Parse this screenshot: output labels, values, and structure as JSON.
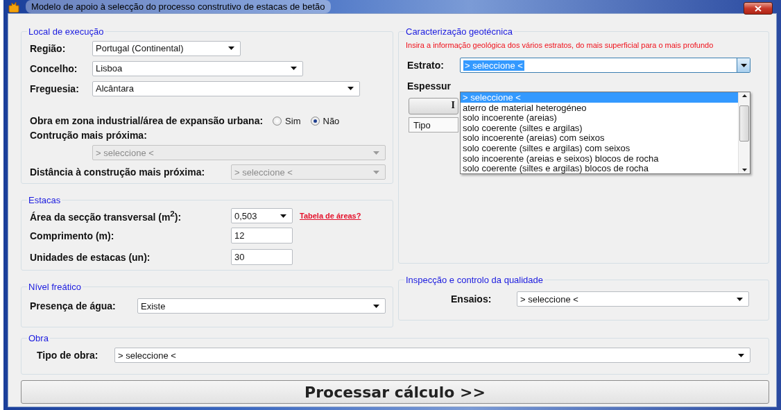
{
  "window": {
    "title": "Modelo de apoio à selecção do processo construtivo de estacas de betão"
  },
  "local_execucao": {
    "legend": "Local de execução",
    "fields": [
      {
        "label": "Região:",
        "value": "Portugal (Continental)"
      },
      {
        "label": "Concelho:",
        "value": "Lisboa"
      },
      {
        "label": "Freguesia:",
        "value": "Alcântara"
      }
    ],
    "industrial_zone": {
      "label": "Obra em zona industrial/área de expansão urbana:",
      "options": [
        {
          "label": "Sim",
          "selected": false
        },
        {
          "label": "Não",
          "selected": true
        }
      ]
    },
    "nearest_construction": {
      "label": "Contrução mais próxima:",
      "value": "> seleccione <",
      "disabled": true
    },
    "distance": {
      "label": "Distância à construção mais próxima:",
      "value": "> seleccione <",
      "disabled": true
    }
  },
  "estacas": {
    "legend": "Estacas",
    "area": {
      "label": "Área da secção transversal (m$^{2}$):",
      "value": "0,503"
    },
    "link": "Tabela de áreas?",
    "length": {
      "label": "Comprimento (m):",
      "value": "12"
    },
    "units": {
      "label": "Unidades de estacas (un):",
      "value": "30"
    }
  },
  "nivel_freatico": {
    "legend": "Nível freático",
    "label": "Presença de água:",
    "value": "Existe"
  },
  "geotecnica": {
    "legend": "Caracterização geotécnica",
    "instruction": "Insira a informação geológica dos vários estratos, do mais superficial para o mais profundo",
    "estrato": {
      "label": "Estrato:",
      "value": "> seleccione <",
      "expanded": true,
      "options": [
        {
          "label": "> seleccione <",
          "selected": true
        },
        {
          "label": "aterro de material heterogéneo",
          "selected": false
        },
        {
          "label": "solo incoerente (areias)",
          "selected": false
        },
        {
          "label": "solo coerente (siltes e argilas)",
          "selected": false
        },
        {
          "label": "solo incoerente (areias) com seixos",
          "selected": false
        },
        {
          "label": "solo coerente (siltes e argilas) com seixos",
          "selected": false
        },
        {
          "label": "solo incoerente (areias e seixos) blocos de rocha",
          "selected": false
        },
        {
          "label": "solo coerente (siltes e argilas) blocos de rocha",
          "selected": false
        }
      ]
    },
    "thickness_label": "Espessur",
    "button_label": "I",
    "table_columns": [
      "Tipo"
    ]
  },
  "inspeccao": {
    "legend": "Inspecção e controlo da qualidade",
    "label": "Ensaios:",
    "value": "> seleccione <"
  },
  "obra": {
    "legend": "Obra",
    "label": "Tipo de obra:",
    "value": "> seleccione <"
  },
  "process_button": "Processar cálculo >>"
}
